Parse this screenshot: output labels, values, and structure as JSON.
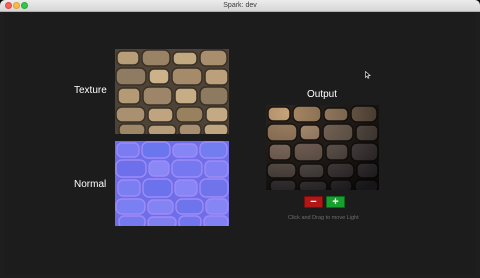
{
  "window": {
    "title": "Spark: dev"
  },
  "labels": {
    "texture": "Texture",
    "normal": "Normal",
    "output": "Output"
  },
  "controls": {
    "minus": "−",
    "plus": "+",
    "hint": "Click and Drag to move Light"
  },
  "icons": {
    "close": "close-icon",
    "minimize": "minimize-icon",
    "maximize": "maximize-icon",
    "cursor": "mouse-pointer-icon"
  },
  "colors": {
    "background": "#1c1c1d",
    "minus_button": "#b01818",
    "plus_button": "#17a02d"
  }
}
